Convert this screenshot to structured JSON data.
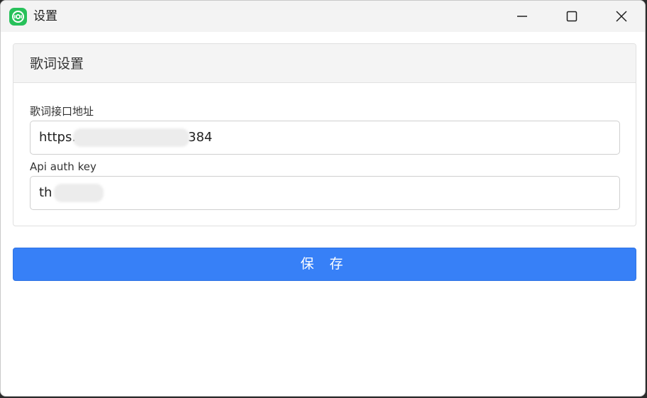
{
  "window": {
    "title": "设置",
    "app_icon": "music-app-icon",
    "controls": {
      "minimize_icon": "minimize-icon",
      "maximize_icon": "maximize-icon",
      "close_icon": "close-icon"
    }
  },
  "lyrics_panel": {
    "title": "歌词设置",
    "fields": [
      {
        "label": "歌词接口地址",
        "value_prefix": "https.",
        "value_suffix": "384"
      },
      {
        "label": "Api auth key",
        "value_prefix": "th"
      }
    ]
  },
  "save_button": {
    "label": "保 存"
  },
  "colors": {
    "accent": "#3780f7",
    "app_icon": "#27c15a"
  }
}
